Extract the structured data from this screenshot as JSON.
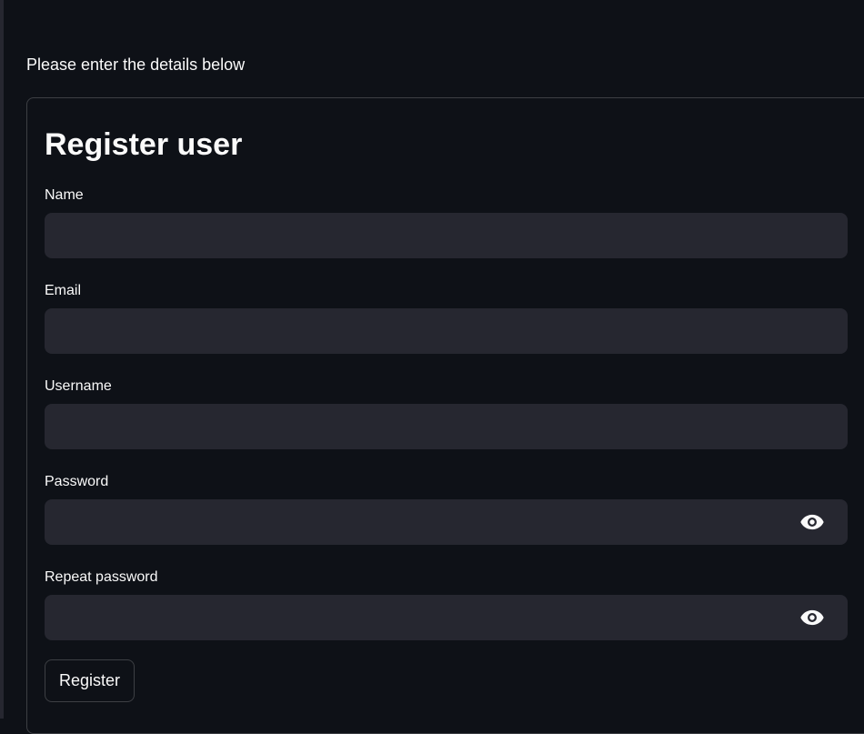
{
  "intro_text": "Please enter the details below",
  "form": {
    "title": "Register user",
    "fields": {
      "name": {
        "label": "Name",
        "value": ""
      },
      "email": {
        "label": "Email",
        "value": ""
      },
      "username": {
        "label": "Username",
        "value": ""
      },
      "password": {
        "label": "Password",
        "value": "",
        "icon": "eye-icon"
      },
      "repeat_password": {
        "label": "Repeat password",
        "value": "",
        "icon": "eye-icon"
      }
    },
    "submit_label": "Register"
  },
  "colors": {
    "background": "#0e1117",
    "input_background": "#262730",
    "text": "#fafafa",
    "border": "rgba(250,250,250,0.2)"
  }
}
